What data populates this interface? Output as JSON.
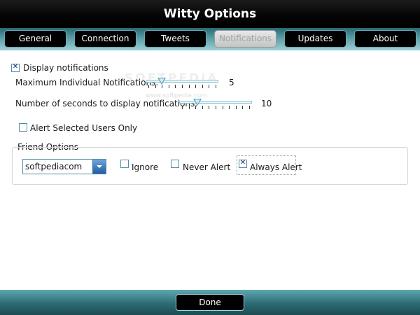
{
  "window": {
    "title": "Witty Options"
  },
  "tabs": [
    {
      "label": "General"
    },
    {
      "label": "Connection"
    },
    {
      "label": "Tweets"
    },
    {
      "label": "Notifications",
      "active": true
    },
    {
      "label": "Updates"
    },
    {
      "label": "About"
    }
  ],
  "notifications": {
    "display_notifications": {
      "label": "Display notifications",
      "checked": true
    },
    "max_notifications": {
      "label": "Maximum Individual Notifications:",
      "value": "5",
      "fraction": 0.16
    },
    "seconds_display": {
      "label": "Number of seconds to display notifications:",
      "value": "10",
      "fraction": 0.19
    },
    "alert_selected_users": {
      "label": "Alert Selected Users Only",
      "checked": false
    }
  },
  "friend_options": {
    "group_label": "Friend Options",
    "selected_user": "softpediacom",
    "ignore": {
      "label": "Ignore",
      "checked": false
    },
    "never_alert": {
      "label": "Never Alert",
      "checked": false
    },
    "always_alert": {
      "label": "Always Alert",
      "checked": true
    }
  },
  "watermark": {
    "text": "SOFTPEDIA",
    "sub": "www.softpedia.com"
  },
  "footer": {
    "done_label": "Done"
  },
  "colors": {
    "title_bg": "#000000",
    "tab_strip": "#5a9ea7",
    "accent": "#4f8fa6",
    "footer": "#2c6b74"
  }
}
